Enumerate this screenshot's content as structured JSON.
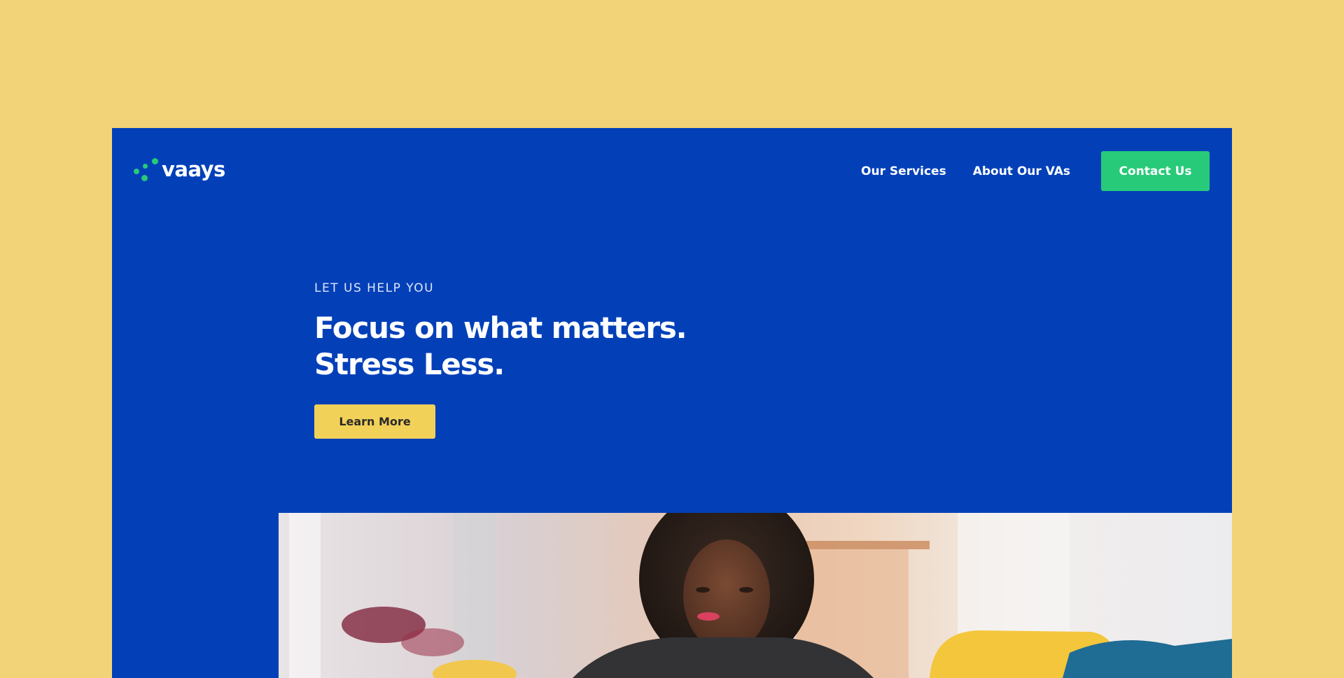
{
  "brand": {
    "name": "vaays",
    "dot_color": "#27ca79"
  },
  "nav": {
    "links": [
      "Our Services",
      "About Our VAs"
    ],
    "contact_label": "Contact Us"
  },
  "hero": {
    "eyebrow": "LET US HELP YOU",
    "headline_line1": "Focus on what matters.",
    "headline_line2": "Stress Less.",
    "cta_label": "Learn More"
  },
  "photo": {
    "subject": "woman with curly hair working at a laptop"
  },
  "colors": {
    "page_background": "#f2d377",
    "hero_background": "#0340b8",
    "accent_green": "#27ca79",
    "cta_yellow": "#f2d159"
  }
}
